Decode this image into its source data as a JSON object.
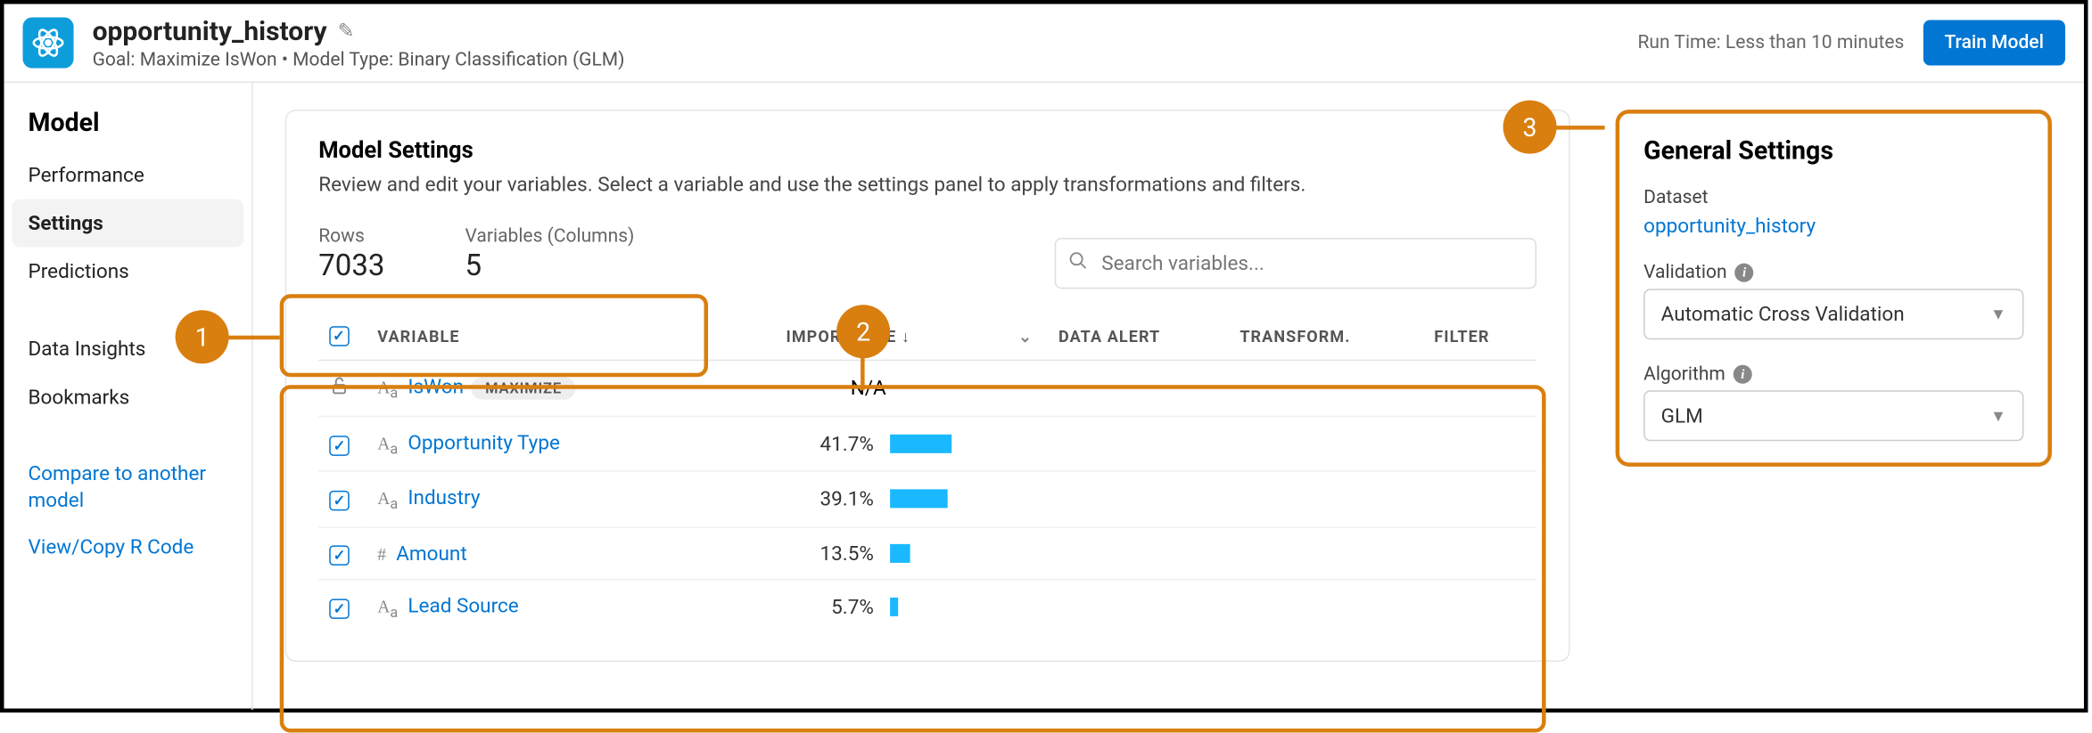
{
  "header": {
    "title": "opportunity_history",
    "subtitle": "Goal: Maximize IsWon • Model Type: Binary Classification (GLM)",
    "runtime": "Run Time: Less than 10 minutes",
    "train_button": "Train Model"
  },
  "sidebar": {
    "title": "Model",
    "items": [
      "Performance",
      "Settings",
      "Predictions"
    ],
    "active_index": 1,
    "secondary": [
      "Data Insights",
      "Bookmarks"
    ],
    "links": [
      "Compare to another model",
      "View/Copy R Code"
    ]
  },
  "main": {
    "title": "Model Settings",
    "description": "Review and edit your variables. Select a variable and use the settings panel to apply transformations and filters.",
    "stats": {
      "rows_label": "Rows",
      "rows_value": "7033",
      "vars_label": "Variables (Columns)",
      "vars_value": "5"
    },
    "search_placeholder": "Search variables...",
    "columns": {
      "variable": "VARIABLE",
      "importance": "IMPORTANCE ↓",
      "data_alert": "DATA ALERT",
      "transform": "TRANSFORM.",
      "filter": "FILTER"
    },
    "rows": [
      {
        "locked": true,
        "type": "text",
        "name": "IsWon",
        "badge": "MAXIMIZE",
        "importance_text": "N/A",
        "importance_pct": null
      },
      {
        "locked": false,
        "type": "text",
        "name": "Opportunity Type",
        "importance_text": "41.7%",
        "importance_pct": 41.7
      },
      {
        "locked": false,
        "type": "text",
        "name": "Industry",
        "importance_text": "39.1%",
        "importance_pct": 39.1
      },
      {
        "locked": false,
        "type": "number",
        "name": "Amount",
        "importance_text": "13.5%",
        "importance_pct": 13.5
      },
      {
        "locked": false,
        "type": "text",
        "name": "Lead Source",
        "importance_text": "5.7%",
        "importance_pct": 5.7
      }
    ]
  },
  "general": {
    "title": "General Settings",
    "dataset_label": "Dataset",
    "dataset_value": "opportunity_history",
    "validation_label": "Validation",
    "validation_value": "Automatic Cross Validation",
    "algorithm_label": "Algorithm",
    "algorithm_value": "GLM"
  },
  "callouts": {
    "c1": "1",
    "c2": "2",
    "c3": "3"
  }
}
